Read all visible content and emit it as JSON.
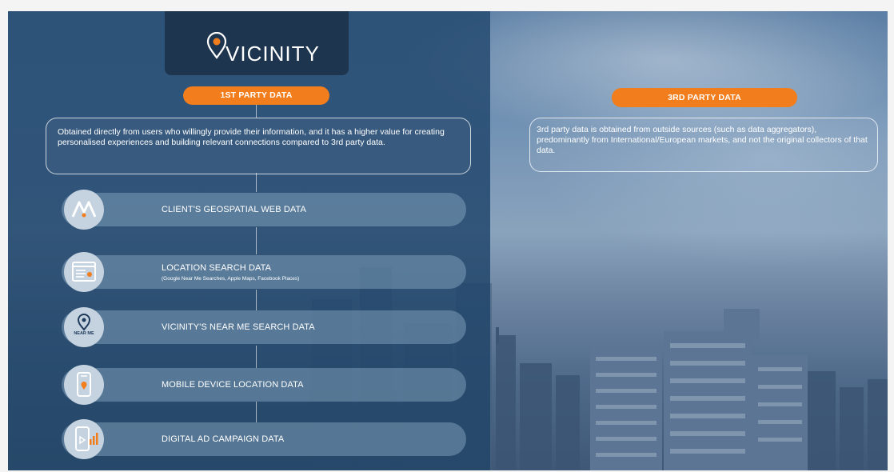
{
  "brand": {
    "name": "VICINITY"
  },
  "first_party": {
    "label": "1ST PARTY DATA",
    "description": "Obtained directly from users who willingly provide their information, and it has a higher value for creating personalised experiences and building relevant connections compared to 3rd party data.",
    "items": [
      {
        "title": "CLIENT'S GEOSPATIAL WEB DATA",
        "subtitle": "",
        "icon": "geospatial-icon"
      },
      {
        "title": "LOCATION SEARCH DATA",
        "subtitle": "(Google Near Me Searches, Apple Maps, Facebook Places)",
        "icon": "search-window-icon"
      },
      {
        "title": "VICINITY'S NEAR ME SEARCH DATA",
        "subtitle": "",
        "icon": "near-me-pin-icon",
        "icon_text": "NEAR ME"
      },
      {
        "title": "MOBILE DEVICE LOCATION DATA",
        "subtitle": "",
        "icon": "mobile-location-icon"
      },
      {
        "title": "DIGITAL AD CAMPAIGN DATA",
        "subtitle": "",
        "icon": "ad-campaign-icon"
      }
    ]
  },
  "third_party": {
    "label": "3RD PARTY DATA",
    "description": "3rd party data is obtained from outside sources (such as data aggregators), predominantly from International/European markets, and not the original collectors of that data."
  },
  "colors": {
    "accent": "#f27d1c",
    "logo_bg": "#1e3550",
    "panel": "#20466c",
    "icon_bg": "#c5d2df"
  }
}
